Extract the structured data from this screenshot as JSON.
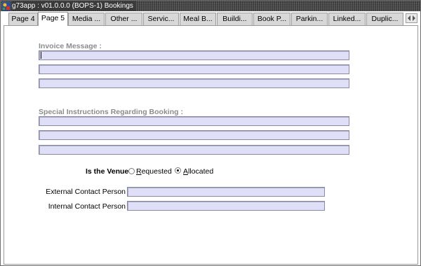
{
  "window": {
    "title": "g73app : v01.0.0.0 (BOPS-1) Bookings"
  },
  "tabs": [
    {
      "label": "Page 4",
      "active": false
    },
    {
      "label": "Page 5",
      "active": true
    },
    {
      "label": "Media ...",
      "active": false
    },
    {
      "label": "Other ...",
      "active": false
    },
    {
      "label": "Servic...",
      "active": false
    },
    {
      "label": "Meal B...",
      "active": false
    },
    {
      "label": "Buildi...",
      "active": false
    },
    {
      "label": "Book P...",
      "active": false
    },
    {
      "label": "Parkin...",
      "active": false
    },
    {
      "label": "Linked...",
      "active": false
    },
    {
      "label": "Duplic...",
      "active": false
    }
  ],
  "invoice": {
    "label": "Invoice Message :",
    "lines": [
      "",
      "",
      ""
    ]
  },
  "special": {
    "label": "Special Instructions Regarding Booking :",
    "lines": [
      "",
      "",
      ""
    ]
  },
  "venue": {
    "label": "Is the Venue",
    "options": [
      {
        "mnemonic": "R",
        "rest": "equested",
        "checked": false
      },
      {
        "mnemonic": "A",
        "rest": "llocated",
        "checked": true
      }
    ]
  },
  "contacts": {
    "external_label": "External Contact Person",
    "external_value": "",
    "internal_label": "Internal Contact Person",
    "internal_value": ""
  },
  "colors": {
    "field_bg": "#dfdff7",
    "label_grey": "#8c8c8c",
    "titlebar": "#3a3a3a"
  }
}
